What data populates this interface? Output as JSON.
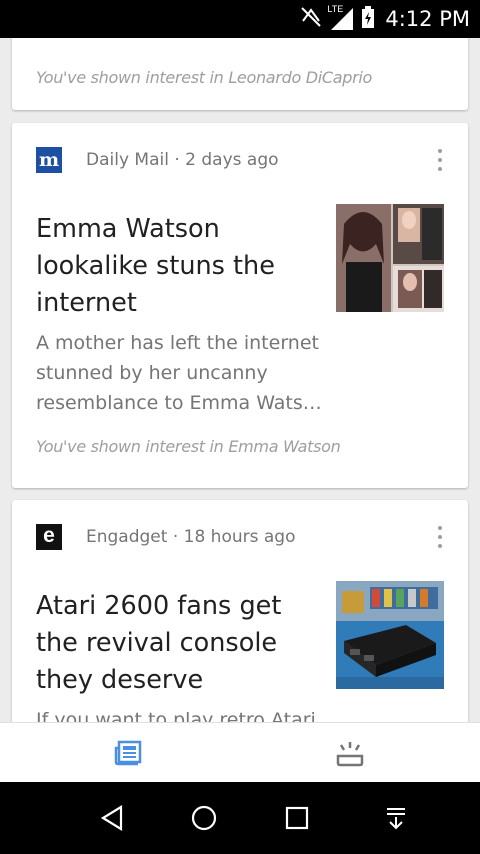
{
  "status_bar": {
    "network": "LTE",
    "time": "4:12 PM"
  },
  "colors": {
    "accent_blue": "#4a90e2",
    "daily_mail_blue": "#1d4fa3"
  },
  "cards": [
    {
      "interest": "You've shown interest in Leonardo DiCaprio"
    },
    {
      "logo": "m",
      "source": "Daily Mail · 2 days ago",
      "headline": "Emma Watson lookalike stuns the internet",
      "snippet": "A mother has left the internet stunned by her uncanny resemblance to Emma Wats…",
      "interest": "You've shown interest in Emma Watson"
    },
    {
      "logo": "e",
      "source": "Engadget · 18 hours ago",
      "headline": "Atari 2600 fans get the revival console they deserve",
      "snippet": "If you want to play retro Atari"
    }
  ],
  "bottom_nav": {
    "left_icon": "newspaper-icon",
    "right_icon": "upcoming-icon"
  },
  "system_nav": {
    "icons": [
      "back-icon",
      "home-icon",
      "recents-icon",
      "notification-shade-icon"
    ]
  }
}
